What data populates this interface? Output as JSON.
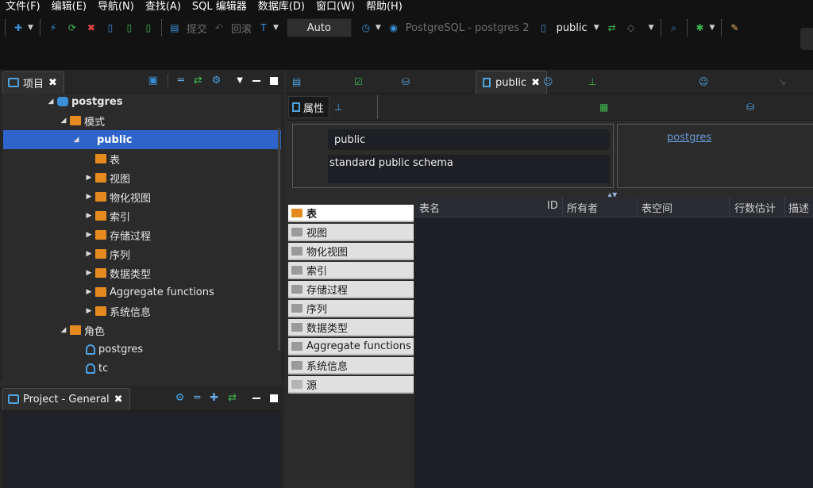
{
  "menu": [
    "文件(F)",
    "编辑(E)",
    "导航(N)",
    "查找(A)",
    "SQL 编辑器",
    "数据库(D)",
    "窗口(W)",
    "帮助(H)"
  ],
  "toolbar": {
    "commit_label": "提交",
    "rollback_label": "回滚",
    "mode_value": "Auto",
    "connection_label": "PostgreSQL - postgres 2",
    "schema_label": "public"
  },
  "project_panel": {
    "tab_label": "项目",
    "tree": [
      {
        "label": "postgres",
        "level": 1,
        "icon": "database-icon",
        "expanded": true
      },
      {
        "label": "模式",
        "level": 2,
        "icon": "schema-folder-icon",
        "expanded": true
      },
      {
        "label": "public",
        "level": 3,
        "icon": "schema-icon",
        "expanded": true,
        "selected": true
      },
      {
        "label": "表",
        "level": 4,
        "icon": "table-icon"
      },
      {
        "label": "视图",
        "level": 4,
        "icon": "view-icon",
        "collapsed": true
      },
      {
        "label": "物化视图",
        "level": 4,
        "icon": "view-icon",
        "collapsed": true
      },
      {
        "label": "索引",
        "level": 4,
        "icon": "folder-icon",
        "collapsed": true
      },
      {
        "label": "存储过程",
        "level": 4,
        "icon": "folder-icon",
        "collapsed": true
      },
      {
        "label": "序列",
        "level": 4,
        "icon": "folder-icon",
        "collapsed": true
      },
      {
        "label": "数据类型",
        "level": 4,
        "icon": "folder-icon",
        "collapsed": true
      },
      {
        "label": "Aggregate functions",
        "level": 4,
        "icon": "folder-icon",
        "collapsed": true
      },
      {
        "label": "系统信息",
        "level": 4,
        "icon": "info-folder-icon",
        "collapsed": true
      },
      {
        "label": "角色",
        "level": 2,
        "icon": "roles-folder-icon",
        "expanded": true
      },
      {
        "label": "postgres",
        "level": 3,
        "icon": "user-icon"
      },
      {
        "label": "tc",
        "level": 3,
        "icon": "user-icon"
      }
    ]
  },
  "general_panel": {
    "tab_label": "Project - General"
  },
  "editor": {
    "tab_label": "public",
    "sub_tab_label": "属性",
    "properties": {
      "name": "public",
      "description": "standard public schema",
      "owner": "postgres"
    },
    "type_list": [
      {
        "label": "表",
        "icon": "table-icon",
        "active": true
      },
      {
        "label": "视图",
        "icon": "view-icon"
      },
      {
        "label": "物化视图",
        "icon": "view-icon"
      },
      {
        "label": "索引",
        "icon": "folder-icon"
      },
      {
        "label": "存储过程",
        "icon": "folder-icon"
      },
      {
        "label": "序列",
        "icon": "folder-icon"
      },
      {
        "label": "数据类型",
        "icon": "folder-icon"
      },
      {
        "label": "Aggregate functions",
        "icon": "folder-icon"
      },
      {
        "label": "系统信息",
        "icon": "info-folder-icon"
      },
      {
        "label": "源",
        "icon": "source-icon"
      }
    ],
    "grid_columns": [
      "表名",
      "ID",
      "所有者",
      "表空间",
      "行数估计",
      "描述"
    ]
  },
  "colors": {
    "selection": "#2f65ca",
    "folder": "#e58a1f",
    "accent_blue": "#4ea3e0",
    "link": "#6a9ad8"
  }
}
